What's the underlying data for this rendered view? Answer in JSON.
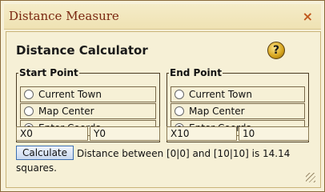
{
  "window": {
    "title": "Distance Measure",
    "close_label": "×"
  },
  "main": {
    "heading": "Distance Calculator",
    "help_label": "?",
    "start": {
      "legend": "Start Point",
      "options": [
        "Current Town",
        "Map Center",
        "Enter Coords"
      ],
      "selected": "Enter Coords",
      "x_value": "X0",
      "y_value": "Y0"
    },
    "end": {
      "legend": "End Point",
      "options": [
        "Current Town",
        "Map Center",
        "Enter Coords"
      ],
      "selected": "Enter Coords",
      "x_value": "X10",
      "y_value": "10"
    },
    "calculate_label": "Calculate",
    "result_text": "Distance between [0|0] and [10|10] is 14.14 squares."
  }
}
